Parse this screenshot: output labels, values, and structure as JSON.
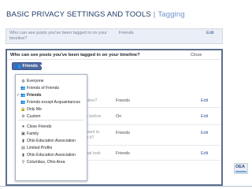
{
  "slide": {
    "title": "BASIC PRIVACY SETTINGS AND TOOLS",
    "separator": "|",
    "subtitle": "Tagging"
  },
  "settings_row": {
    "question": "Who can see posts you've been tagged in on your timeline?",
    "value": "Friends",
    "edit": "Edit"
  },
  "dialog": {
    "title": "Who can see posts you've been tagged in on your timeline?",
    "close": "Close",
    "audience_button": "Friends",
    "rows": [
      {
        "question": "eline?",
        "value": "Friends",
        "edit": "Edit"
      },
      {
        "question": "s before",
        "value": "On",
        "edit": "Edit"
      },
      {
        "question": "want to",
        "question2": "n it?",
        "value": "Friends",
        "edit": "Edit"
      },
      {
        "question": "hat look",
        "value": "Friends",
        "edit": "Edit"
      }
    ]
  },
  "audience_menu": {
    "items": [
      {
        "label": "Everyone",
        "icon": "globe-icon",
        "glyph": "◍",
        "selected": false
      },
      {
        "label": "Friends of Friends",
        "icon": "friends-of-friends-icon",
        "glyph": "👥",
        "selected": false
      },
      {
        "label": "Friends",
        "icon": "friends-icon",
        "glyph": "👥",
        "selected": true
      },
      {
        "label": "Friends except Acquaintances",
        "icon": "friends-except-icon",
        "glyph": "👥",
        "selected": false
      },
      {
        "label": "Only Me",
        "icon": "lock-icon",
        "glyph": "🔒",
        "selected": false
      },
      {
        "label": "Custom",
        "icon": "gear-icon",
        "glyph": "⚙",
        "selected": false
      },
      {
        "label": "Close Friends",
        "icon": "star-icon",
        "glyph": "★",
        "selected": false
      },
      {
        "label": "Family",
        "icon": "family-icon",
        "glyph": "▣",
        "selected": false
      },
      {
        "label": "Ohio Education Association",
        "icon": "organization-icon",
        "glyph": "▮",
        "selected": false
      },
      {
        "label": "Limited Profile",
        "icon": "list-icon",
        "glyph": "▤",
        "selected": false
      },
      {
        "label": "Ohio Education Association",
        "icon": "organization-icon",
        "glyph": "▮",
        "selected": false
      },
      {
        "label": "Columbus, Ohio Area",
        "icon": "location-pin-icon",
        "glyph": "⚲",
        "selected": false
      }
    ],
    "check_glyph": "✓"
  },
  "logo": {
    "text": "OEA"
  },
  "colors": {
    "fb_blue": "#3b5998",
    "button_blue": "#4e69a2",
    "title_navy": "#1f3b66",
    "subtitle_blue": "#6d93c8"
  }
}
